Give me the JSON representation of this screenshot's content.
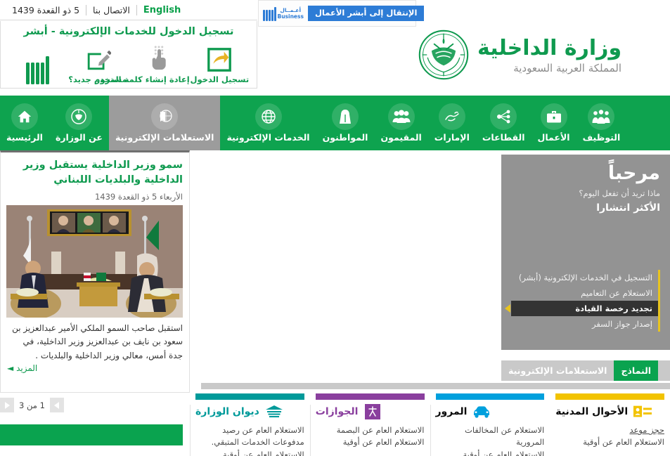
{
  "topbar": {
    "items": [
      {
        "label": "5 ذو القعدة 1439",
        "name": "hijri-date"
      },
      {
        "label": "الاتصال بنا",
        "name": "contact-us-link"
      },
      {
        "label": "English",
        "name": "english-language-link"
      }
    ]
  },
  "ad": {
    "button_label": "الإنتقال إلى أبشر الأعمال",
    "logo_line1": "أعـمــال",
    "logo_line2": "Business"
  },
  "absher": {
    "title": "تسجيل الدخول للخدمات الإلكترونية - أبشر",
    "items": [
      {
        "label": "تسجيل الدخول",
        "icon": "login-arrow-icon"
      },
      {
        "label": "إعادة إنشاء كلمة المرور",
        "icon": "hand-keypad-icon"
      },
      {
        "label": "مستخدم جديد؟",
        "icon": "edit-pencil-square-icon"
      }
    ],
    "logo_name": "absher-logo"
  },
  "brand": {
    "title": "وزارة الداخلية",
    "subtitle": "المملكة العربية السعودية",
    "emblem_name": "saudi-moi-emblem"
  },
  "nav": {
    "items": [
      {
        "label": "الرئيسية",
        "icon": "home-icon",
        "active": false
      },
      {
        "label": "عن الوزارة",
        "icon": "emblem-icon",
        "active": false
      },
      {
        "label": "الاستعلامات الإلكترونية",
        "icon": "globe-document-icon",
        "active": true
      },
      {
        "label": "الخدمات الإلكترونية",
        "icon": "globe-icon",
        "active": false
      },
      {
        "label": "المواطنون",
        "icon": "citizen-icon",
        "active": false
      },
      {
        "label": "المقيمون",
        "icon": "people-group-icon",
        "active": false
      },
      {
        "label": "الإمارات",
        "icon": "calligraphy-icon",
        "active": false
      },
      {
        "label": "القطاعات",
        "icon": "network-nodes-icon",
        "active": false
      },
      {
        "label": "الأعمال",
        "icon": "briefcase-icon",
        "active": false
      },
      {
        "label": "التوظيف",
        "icon": "hiring-people-icon",
        "active": false
      }
    ]
  },
  "news": {
    "title": "سمو وزير الداخلية يستقبل وزير الداخلية والبلديات اللبناني",
    "date": "الأربعاء 5 ذو القعدة 1439",
    "body": "استقبل صاحب السمو الملكي الأمير عبدالعزيز بن سعود بن نايف بن عبدالعزيز وزير الداخلية، في جدة أمس، معالي وزير الداخلية والبلديات .",
    "more_label": "المزيد",
    "pager_text": "1 من 3",
    "photo_name": "news-photo-minister-meeting"
  },
  "welcome": {
    "heading": "مرحباً",
    "question": "ماذا تريد أن تفعل اليوم؟",
    "subheading": "الأكثر انتشارا",
    "services": [
      {
        "label": "التسجيل في الخدمات الإلكترونية (أبشر)",
        "active": false
      },
      {
        "label": "الاستعلام عن التعاميم",
        "active": false
      },
      {
        "label": "تجديد رخصة القيادة",
        "active": true
      },
      {
        "label": "إصدار جواز السفر",
        "active": false
      }
    ]
  },
  "tabs": [
    {
      "label": "الاستعلامات الإلكترونية",
      "active": false
    },
    {
      "label": "النماذج",
      "active": true
    }
  ],
  "cards": [
    {
      "title": "ديوان الوزارة",
      "color": "#009a9a",
      "icon": "ministry-diwan-icon",
      "links": [
        "الاستعلام العام عن رصيد مدفوعات الخدمات المتبقي.",
        "الاستعلام العام عن أوقية"
      ]
    },
    {
      "title": "الجوازات",
      "color": "#8a3f9e",
      "icon": "passport-emblem-icon",
      "links": [
        "الاستعلام العام عن البصمة",
        "الاستعلام العام عن أوقية"
      ]
    },
    {
      "title": "المرور",
      "color": "#00a0dd",
      "icon": "car-icon",
      "links": [
        "الاستعلام عن المخالفات المرورية",
        "الاستعلام العام عن أوقية"
      ]
    },
    {
      "title": "الأحوال المدنية",
      "color": "#f2c300",
      "icon": "id-card-icon",
      "links": [
        "حجز موعد",
        "الاستعلام العام عن أوقية"
      ]
    }
  ]
}
